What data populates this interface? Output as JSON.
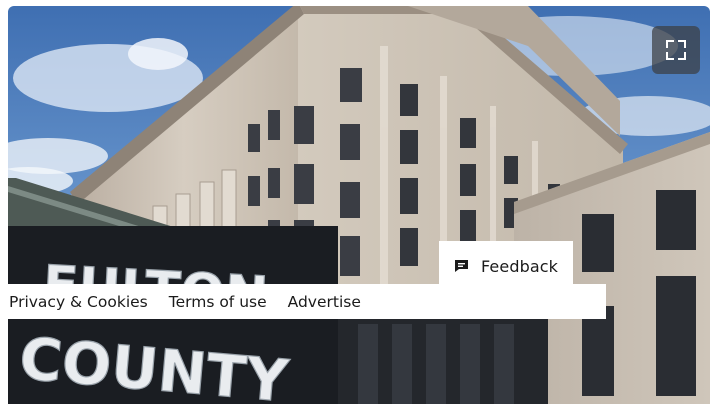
{
  "hero": {
    "image_description": "Fulton County government building",
    "sign_text": "FULTON COUNTY",
    "colors": {
      "sky": "#5a88c4",
      "stone": "#cfc6ba",
      "sign_panel": "#15181c"
    }
  },
  "expand_button": {
    "icon": "expand-icon"
  },
  "feedback": {
    "label": "Feedback",
    "icon": "feedback-icon"
  },
  "footer": {
    "links": [
      {
        "label": "Privacy & Cookies"
      },
      {
        "label": "Terms of use"
      },
      {
        "label": "Advertise"
      }
    ]
  }
}
